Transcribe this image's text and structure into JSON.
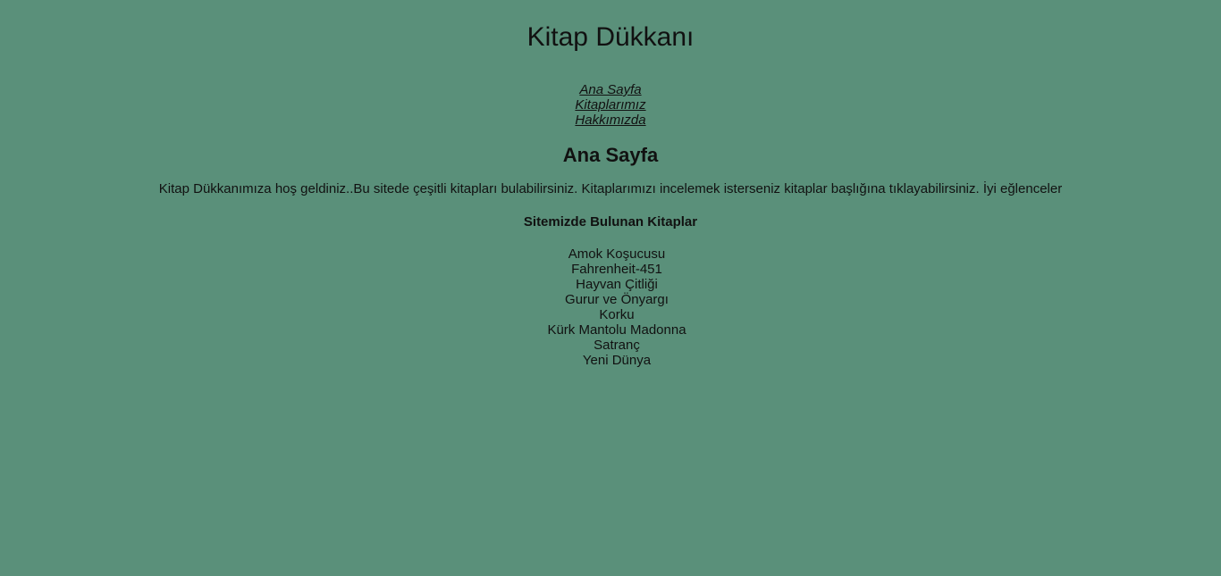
{
  "header": {
    "title": "Kitap Dükkanı"
  },
  "nav": {
    "items": [
      {
        "label": "Ana Sayfa"
      },
      {
        "label": "Kitaplarımız"
      },
      {
        "label": "Hakkımızda"
      }
    ]
  },
  "main": {
    "section_title": "Ana Sayfa",
    "intro": "Kitap Dükkanımıza hoş geldiniz..Bu sitede çeşitli kitapları bulabilirsiniz. Kitaplarımızı incelemek isterseniz kitaplar başlığına tıklayabilirsiniz. İyi eğlenceler",
    "books_heading": "Sitemizde Bulunan Kitaplar",
    "books": [
      "Amok Koşucusu",
      "Fahrenheit-451",
      "Hayvan Çitliği",
      "Gurur ve Önyargı",
      "Korku",
      "Kürk Mantolu Madonna",
      "Satranç",
      "Yeni Dünya"
    ]
  },
  "colors": {
    "background": "#5a907a",
    "text": "#111111"
  }
}
